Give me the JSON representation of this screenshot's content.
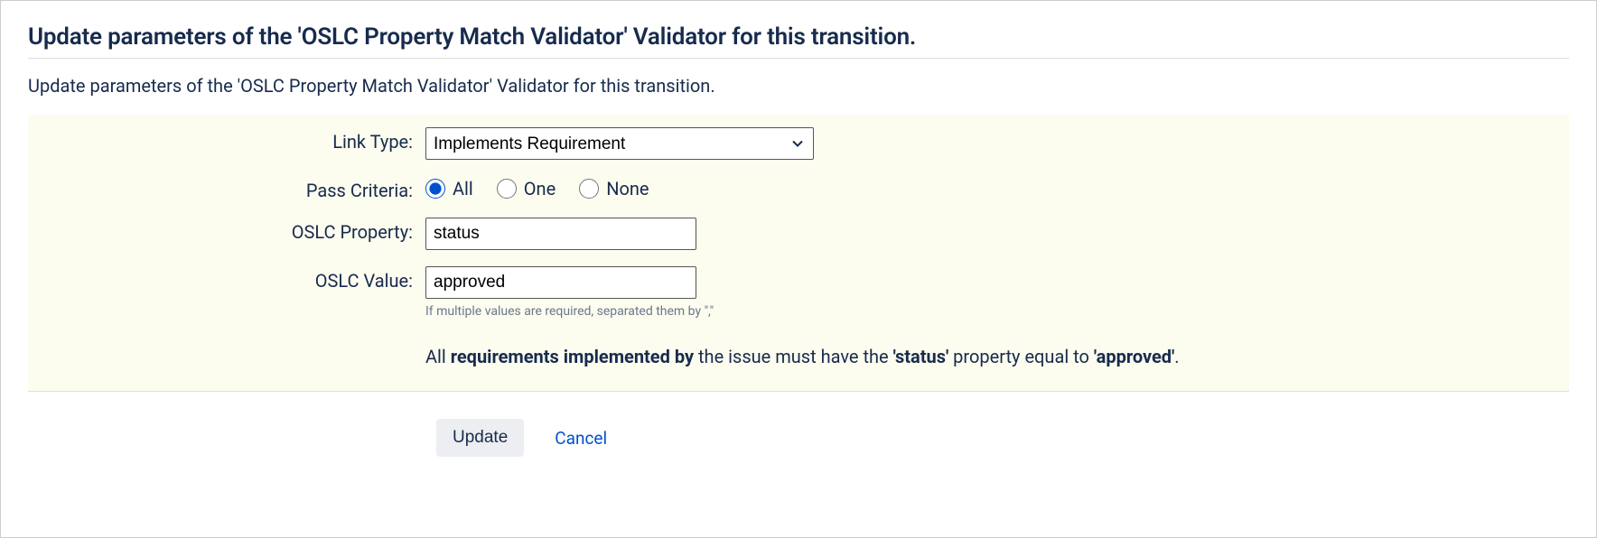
{
  "page": {
    "title": "Update parameters of the 'OSLC Property Match Validator' Validator for this transition.",
    "description": "Update parameters of the 'OSLC Property Match Validator' Validator for this transition."
  },
  "form": {
    "link_type": {
      "label": "Link Type:",
      "value": "Implements Requirement"
    },
    "pass_criteria": {
      "label": "Pass Criteria:",
      "options": {
        "all": "All",
        "one": "One",
        "none": "None"
      },
      "selected": "all"
    },
    "oslc_property": {
      "label": "OSLC Property:",
      "value": "status"
    },
    "oslc_value": {
      "label": "OSLC Value:",
      "value": "approved",
      "hint": "If multiple values are required, separated them by \",\""
    },
    "summary": {
      "prefix": "All ",
      "bold1": "requirements implemented by",
      "middle1": " the issue must have the ",
      "bold2": "'status'",
      "middle2": " property equal to ",
      "bold3": "'approved'",
      "suffix": "."
    }
  },
  "buttons": {
    "update": "Update",
    "cancel": "Cancel"
  }
}
